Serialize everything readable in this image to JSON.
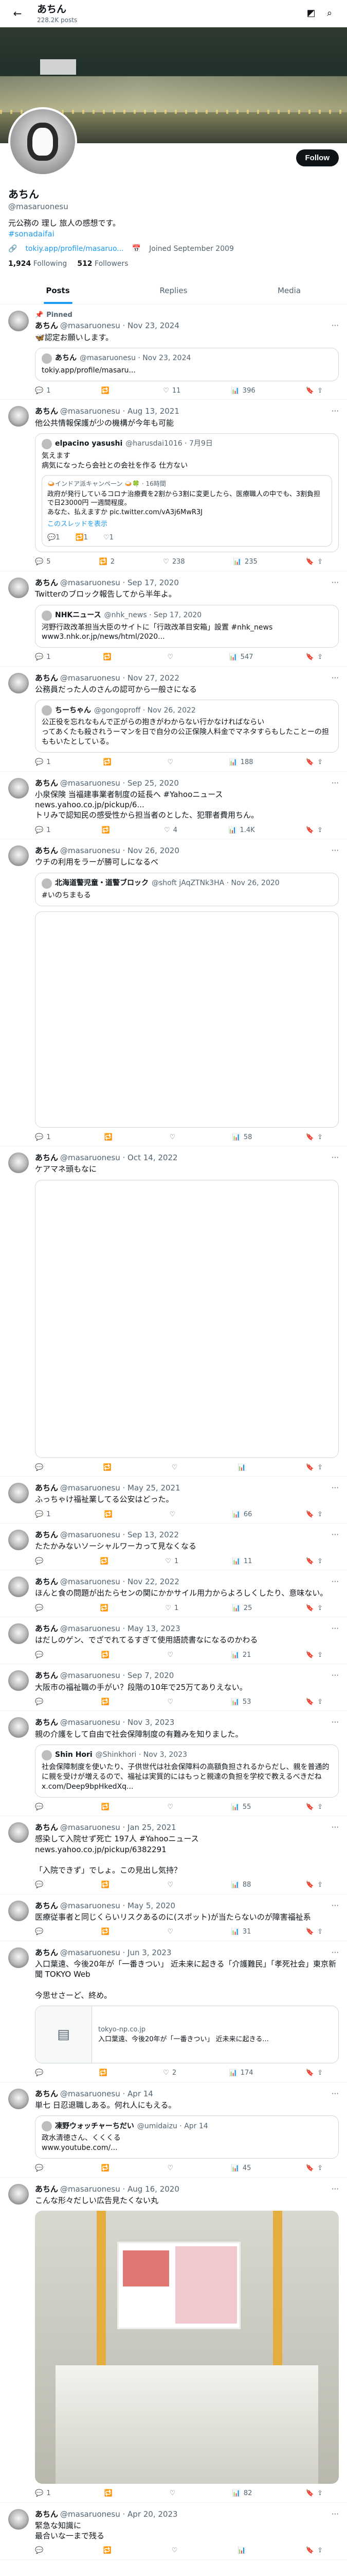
{
  "topnav": {
    "name": "あちん",
    "post_count": "228.2K posts"
  },
  "profile": {
    "name": "あちん",
    "handle": "@masaruonesu",
    "bio": "元公務の 理し 旅人の感想です。",
    "hashtag": "#sonadaifai",
    "link": "tokiy.app/profile/masaruo...",
    "joined": "Joined September 2009",
    "following_count": "1,924",
    "following_label": "Following",
    "followers_count": "512",
    "followers_label": "Followers",
    "follow_button": "Follow"
  },
  "tabs": [
    {
      "label": "Posts"
    },
    {
      "label": "Replies"
    },
    {
      "label": "Media"
    }
  ],
  "tweets": [
    {
      "pinned": "Pinned",
      "name": "あちん",
      "meta": "@masaruonesu · Nov 23, 2024",
      "text": "🦋認定お願いします。",
      "quote": {
        "name": "あちん",
        "meta": "@masaruonesu · Nov 23, 2024",
        "text": "tokiy.app/profile/masaru..."
      },
      "actions": {
        "reply": "1",
        "retweet": "",
        "like": "11",
        "views": "396"
      }
    },
    {
      "name": "あちん",
      "meta": "@masaruonesu · Aug 13, 2021",
      "text": "他公共情報保護が少の機構が今年も可能",
      "quote": {
        "name": "elpacino yasushi",
        "meta": "@harusdai1016 · 7月9日",
        "text": "気えます\n病気になったら会社との会社を作る 仕方ない",
        "inner": {
          "head": "🍛インドア派キャンペーン 🍛🍀 · 16時間",
          "text": "政府が発行しているコロナ治療費を2割から3割に変更したら、医療職人の中でも、3割負担で日23000円 一週間程度。\nあなた、払えますか pic.twitter.com/vA3j6MwR3J",
          "link": "このスレッドを表示",
          "actions": [
            "1",
            "1",
            "1"
          ]
        }
      },
      "actions": {
        "reply": "5",
        "retweet": "2",
        "like": "238",
        "views": "235"
      }
    },
    {
      "name": "あちん",
      "meta": "@masaruonesu · Sep 17, 2020",
      "text": "Twitterのブロック報告してから半年よ。",
      "quote": {
        "name": "NHKニュース",
        "meta": "@nhk_news · Sep 17, 2020",
        "text": "河野行政改革担当大臣のサイトに「行政改革目安箱」設置 #nhk_news\nwww3.nhk.or.jp/news/html/2020..."
      },
      "actions": {
        "reply": "1",
        "retweet": "",
        "like": "",
        "views": "547"
      }
    },
    {
      "name": "あちん",
      "meta": "@masaruonesu · Nov 27, 2022",
      "text": "公務員だった人のさんの認可から一般さになる",
      "quote": {
        "name": "ちーちゃん",
        "meta": "@gongoproff · Nov 26, 2022",
        "text": "公正役を忘れなもんで正がらの抱きがわからない行かなければならい\nってあくたも殺されうーマンを日で自分の公正保険人料金でマネタすらもしたことーの担ももいたとしている。"
      },
      "actions": {
        "reply": "1",
        "retweet": "",
        "like": "",
        "views": "188"
      }
    },
    {
      "name": "あちん",
      "meta": "@masaruonesu · Sep 25, 2020",
      "text": "小泉保険 当福建事業者制度の延長へ #Yahooニュース\nnews.yahoo.co.jp/pickup/6...\nトリみで認知民の感受性から担当者のとした、犯罪者費用ちん。",
      "actions": {
        "reply": "1",
        "retweet": "",
        "like": "4",
        "views": "1.4K"
      }
    },
    {
      "name": "あちん",
      "meta": "@masaruonesu · Nov 26, 2020",
      "text": "ウチの利用をラーが勝可しになるべ",
      "quote": {
        "name": "北海道警児童・道警ブロック",
        "meta": "@shoft jAqZTNk3HA · Nov 26, 2020",
        "text": "#いのちまもる"
      },
      "media": "tall",
      "actions": {
        "reply": "1",
        "retweet": "",
        "like": "",
        "views": "58"
      }
    },
    {
      "name": "あちん",
      "meta": "@masaruonesu · Oct 14, 2022",
      "text": "ケアマネ頭もなに",
      "media": "xtall",
      "actions": {
        "reply": "",
        "retweet": "",
        "like": "",
        "views": ""
      }
    },
    {
      "name": "あちん",
      "meta": "@masaruonesu · May 25, 2021",
      "text": "ふっちゃけ福祉業してる公安はどった。",
      "actions": {
        "reply": "1",
        "retweet": "",
        "like": "",
        "views": "66"
      }
    },
    {
      "name": "あちん",
      "meta": "@masaruonesu · Sep 13, 2022",
      "text": "たたかみないソーシャルワーカって見なくなる",
      "actions": {
        "reply": "",
        "retweet": "",
        "like": "1",
        "views": "11"
      }
    },
    {
      "name": "あちん",
      "meta": "@masaruonesu · Nov 22, 2022",
      "text": "ほんと食の問題が出たらセンの関にかかサイル用力からよろしくしたり、意味ない。",
      "actions": {
        "reply": "",
        "retweet": "",
        "like": "1",
        "views": "25"
      }
    },
    {
      "name": "あちん",
      "meta": "@masaruonesu · May 13, 2023",
      "text": "はだしのゲン、でざでれてるすぎて使用語読書なになるのかわる",
      "actions": {
        "reply": "",
        "retweet": "",
        "like": "",
        "views": "21"
      }
    },
    {
      "name": "あちん",
      "meta": "@masaruonesu · Sep 7, 2020",
      "text": "大阪市の福祉職の手がい？段階の10年で25万てありえない。",
      "actions": {
        "reply": "",
        "retweet": "",
        "like": "",
        "views": "53"
      }
    },
    {
      "name": "あちん",
      "meta": "@masaruonesu · Nov 3, 2023",
      "text": "親の介護をして自由で社会保障制度の有難みを知りました。",
      "quote": {
        "name": "Shin Hori",
        "meta": "@Shinkhori · Nov 3, 2023",
        "text": "社会保障制度を使いたり、子供世代は社会保障料の高額負担されるからだし、親を普通的に親を受けが増えるので、福祉は実質的にはもっと親達の負担を学校で教えるべきだね x.com/Deep9bpHkedXq..."
      },
      "actions": {
        "reply": "",
        "retweet": "",
        "like": "",
        "views": "55"
      }
    },
    {
      "name": "あちん",
      "meta": "@masaruonesu · Jan 25, 2021",
      "text": "感染して入院せず死亡 197人 #Yahooニュース\nnews.yahoo.co.jp/pickup/6382291\n\n「入院できず」でしょ。この見出し気持？",
      "actions": {
        "reply": "",
        "retweet": "",
        "like": "",
        "views": "88"
      }
    },
    {
      "name": "あちん",
      "meta": "@masaruonesu · May 5, 2020",
      "text": "医療従事者と同じくらいリスクあるのに(スポット)が当たらないのが障害福祉系",
      "actions": {
        "reply": "",
        "retweet": "",
        "like": "",
        "views": "31"
      }
    },
    {
      "name": "あちん",
      "meta": "@masaruonesu · Jun 3, 2023",
      "text": "入口葉遠、今後20年が「一番きつい」 近未来に起きる「介護難民」「孝死社会」東京新聞 TOKYO Web\n\n今思せさーど、終め。",
      "card": {
        "domain": "tokyo-np.co.jp",
        "title": "入口葉遠、今後20年が「一番きつい」 近未来に起きる..."
      },
      "actions": {
        "reply": "",
        "retweet": "",
        "like": "2",
        "views": "174"
      }
    },
    {
      "name": "あちん",
      "meta": "@masaruonesu · Apr 14",
      "text": "単七 日忍退職しある。何れ人にもえる。",
      "quote": {
        "name": "凍野ウォッチャーちだい",
        "meta": "@umidaizu · Apr 14",
        "text": "政水清徳さん、くくくる\nwww.youtube.com/..."
      },
      "actions": {
        "reply": "",
        "retweet": "",
        "like": "",
        "views": "45"
      }
    },
    {
      "name": "あちん",
      "meta": "@masaruonesu · Aug 16, 2020",
      "text": "こんな形々だしい広告見たくない丸",
      "photo": true,
      "actions": {
        "reply": "1",
        "retweet": "",
        "like": "",
        "views": "82"
      }
    },
    {
      "name": "あちん",
      "meta": "@masaruonesu · Apr 20, 2023",
      "text": "緊急な知識に\n最合いな一まで残る",
      "actions": {
        "reply": "",
        "retweet": "",
        "like": "",
        "views": ""
      }
    }
  ],
  "colors": {
    "accent": "#1d9bf0",
    "text": "#0f1419",
    "muted": "#536471",
    "border": "#eff3f4"
  },
  "icons": {
    "back": "arrow-left-icon",
    "reply": "reply-icon",
    "retweet": "retweet-icon",
    "like": "heart-icon",
    "views": "bar-chart-icon",
    "bookmark": "bookmark-icon",
    "share": "share-icon"
  }
}
